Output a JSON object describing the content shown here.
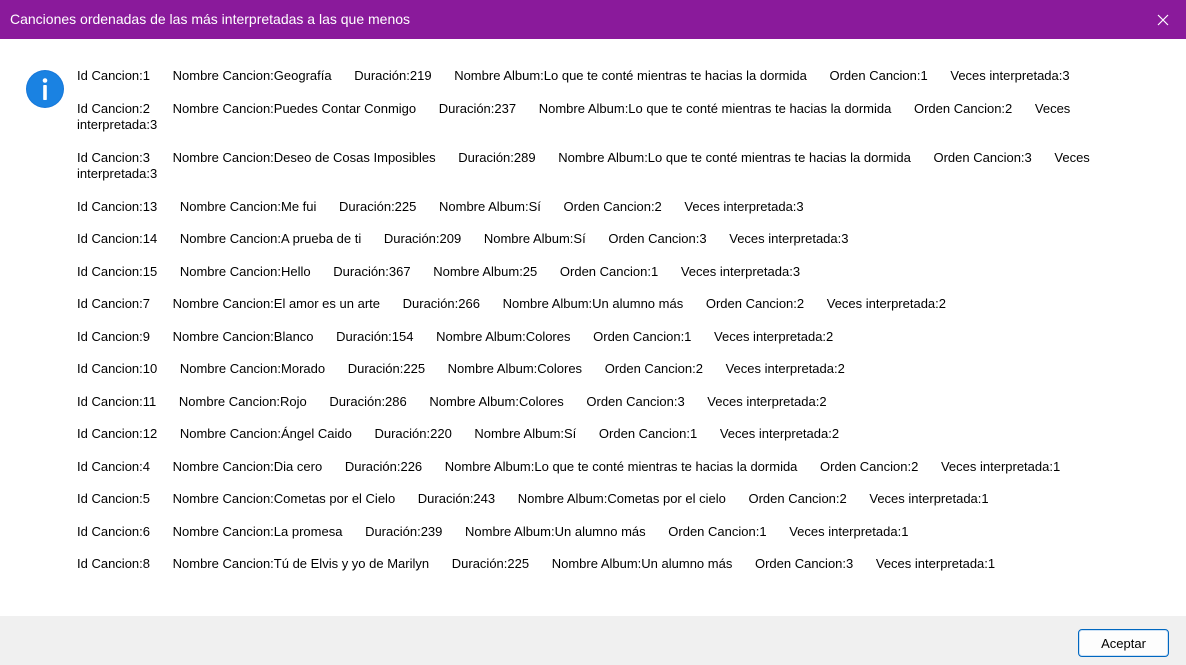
{
  "window": {
    "title": "Canciones ordenadas de las más interpretadas a las que menos",
    "titlebar_color": "#8a1a9b"
  },
  "icons": {
    "info": "info-icon",
    "close": "close-icon"
  },
  "songs": [
    [
      "Id Cancion:1",
      "Nombre Cancion:Geografía",
      "Duración:219",
      "Nombre Album:Lo que te conté mientras te hacias la dormida",
      "Orden Cancion:1",
      "Veces interpretada:3"
    ],
    [
      "Id Cancion:2",
      "Nombre Cancion:Puedes Contar Conmigo",
      "Duración:237",
      "Nombre Album:Lo que te conté mientras te hacias la dormida",
      "Orden Cancion:2",
      "Veces interpretada:3"
    ],
    [
      "Id Cancion:3",
      "Nombre Cancion:Deseo de Cosas Imposibles",
      "Duración:289",
      "Nombre Album:Lo que te conté mientras te hacias la dormida",
      "Orden Cancion:3",
      "Veces interpretada:3"
    ],
    [
      "Id Cancion:13",
      "Nombre Cancion:Me fui",
      "Duración:225",
      "Nombre Album:Sí",
      "Orden Cancion:2",
      "Veces interpretada:3"
    ],
    [
      "Id Cancion:14",
      "Nombre Cancion:A prueba de ti",
      "Duración:209",
      "Nombre Album:Sí",
      "Orden Cancion:3",
      "Veces interpretada:3"
    ],
    [
      "Id Cancion:15",
      "Nombre Cancion:Hello",
      "Duración:367",
      "Nombre Album:25",
      "Orden Cancion:1",
      "Veces interpretada:3"
    ],
    [
      "Id Cancion:7",
      "Nombre Cancion:El amor es un arte",
      "Duración:266",
      "Nombre Album:Un alumno más",
      "Orden Cancion:2",
      "Veces interpretada:2"
    ],
    [
      "Id Cancion:9",
      "Nombre Cancion:Blanco",
      "Duración:154",
      "Nombre Album:Colores",
      "Orden Cancion:1",
      "Veces interpretada:2"
    ],
    [
      "Id Cancion:10",
      "Nombre Cancion:Morado",
      "Duración:225",
      "Nombre Album:Colores",
      "Orden Cancion:2",
      "Veces interpretada:2"
    ],
    [
      "Id Cancion:11",
      "Nombre Cancion:Rojo",
      "Duración:286",
      "Nombre Album:Colores",
      "Orden Cancion:3",
      "Veces interpretada:2"
    ],
    [
      "Id Cancion:12",
      "Nombre Cancion:Ángel Caido",
      "Duración:220",
      "Nombre Album:Sí",
      "Orden Cancion:1",
      "Veces interpretada:2"
    ],
    [
      "Id Cancion:4",
      "Nombre Cancion:Dia cero",
      "Duración:226",
      "Nombre Album:Lo que te conté mientras te hacias la dormida",
      "Orden Cancion:2",
      "Veces interpretada:1"
    ],
    [
      "Id Cancion:5",
      "Nombre Cancion:Cometas por el Cielo",
      "Duración:243",
      "Nombre Album:Cometas por el cielo",
      "Orden Cancion:2",
      "Veces interpretada:1"
    ],
    [
      "Id Cancion:6",
      "Nombre Cancion:La promesa",
      "Duración:239",
      "Nombre Album:Un alumno más",
      "Orden Cancion:1",
      "Veces interpretada:1"
    ],
    [
      "Id Cancion:8",
      "Nombre Cancion:Tú de Elvis y yo de Marilyn",
      "Duración:225",
      "Nombre Album:Un alumno más",
      "Orden Cancion:3",
      "Veces interpretada:1"
    ]
  ],
  "buttons": {
    "ok_label": "Aceptar"
  }
}
